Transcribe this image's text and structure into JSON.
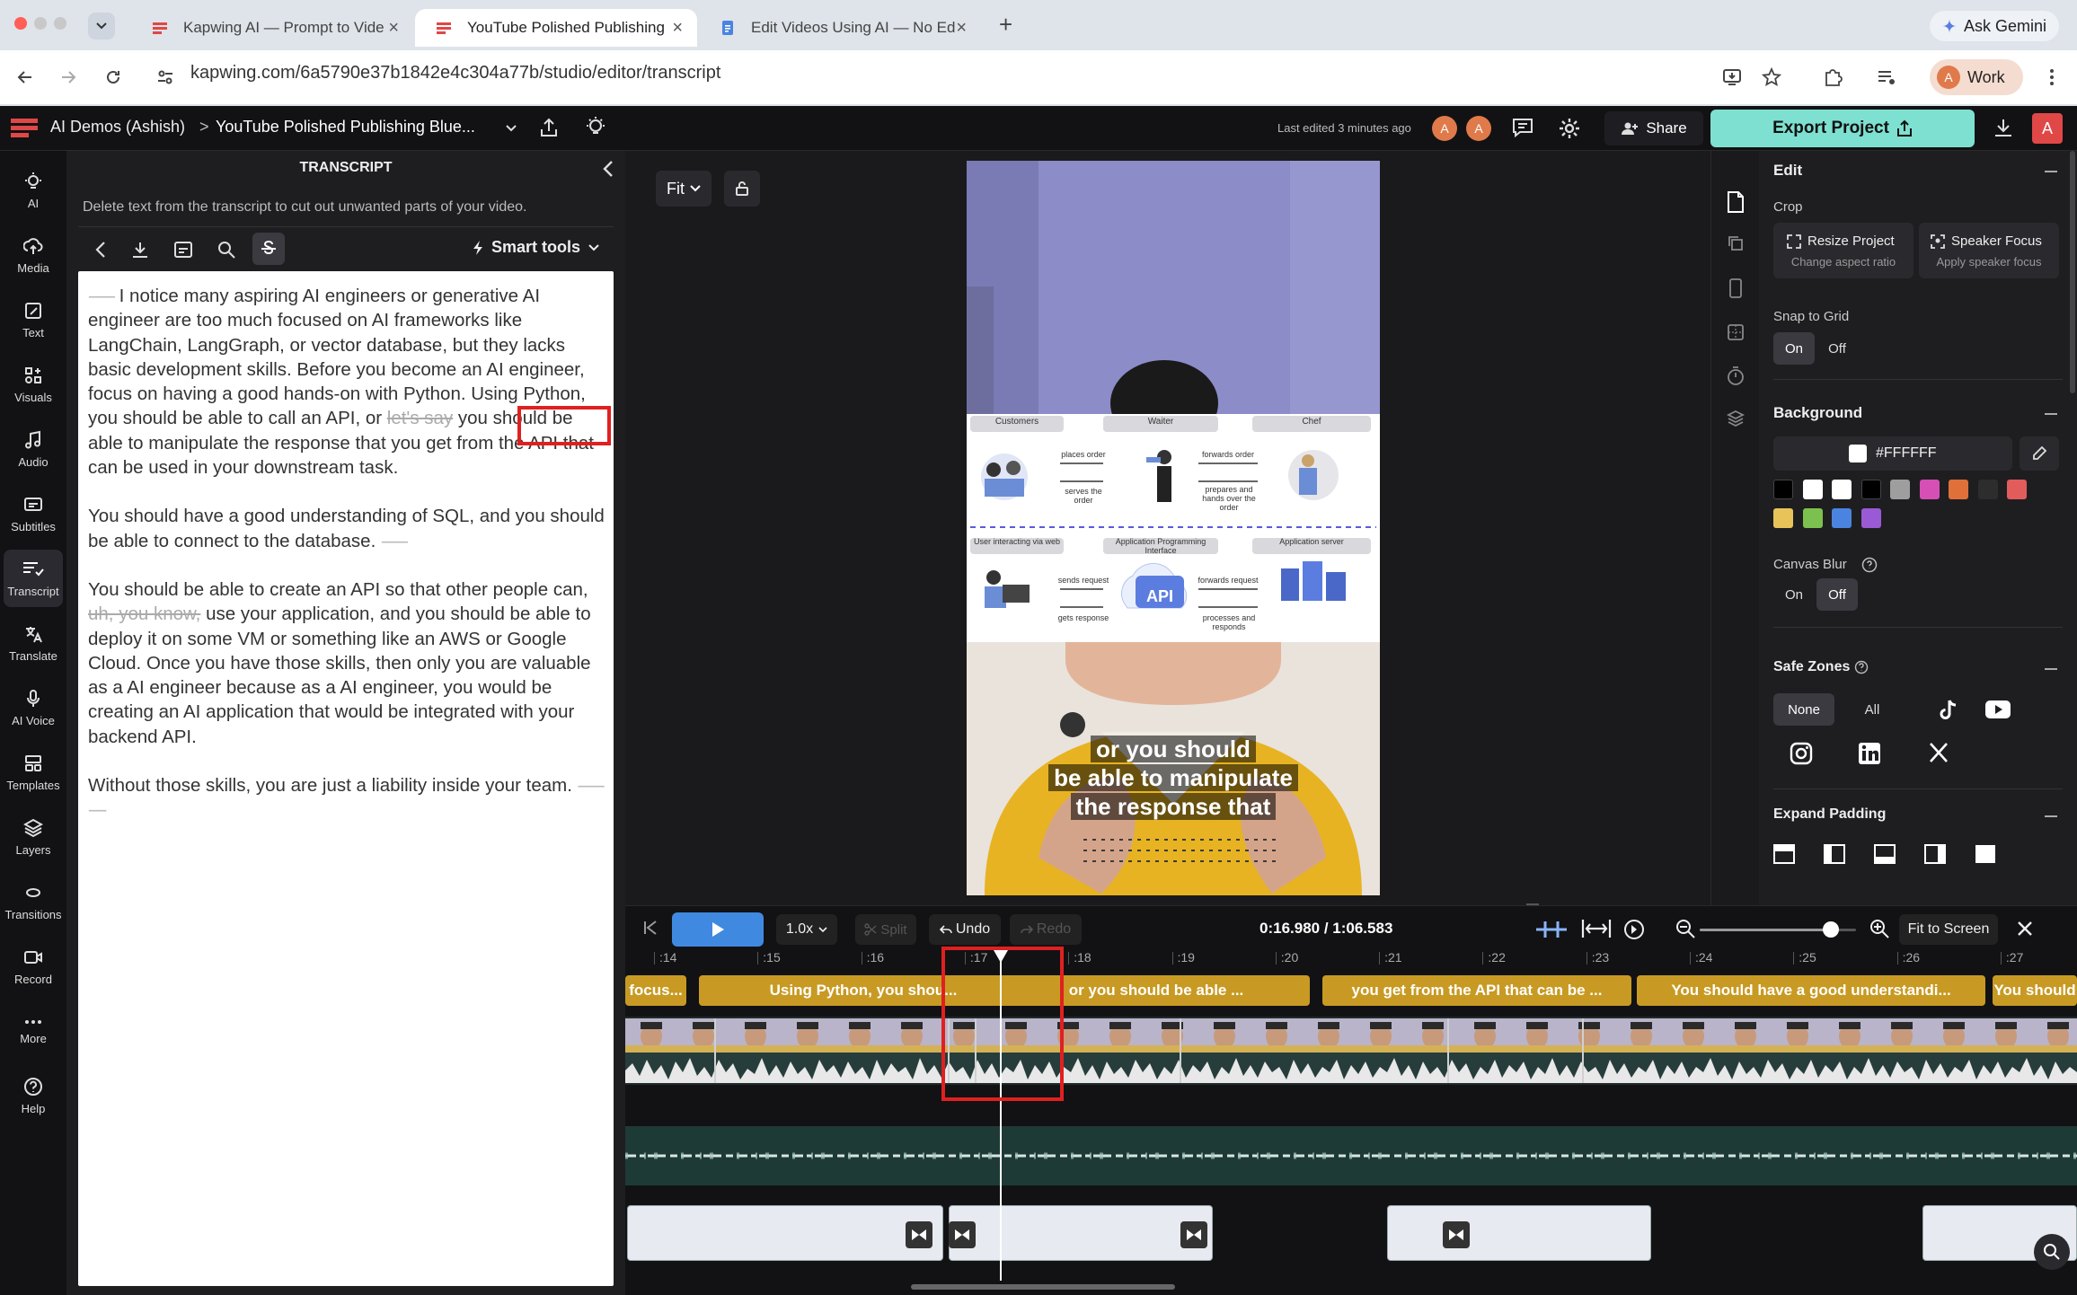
{
  "browser": {
    "tabs": [
      {
        "title": "Kapwing AI — Prompt to Vide",
        "active": false
      },
      {
        "title": "YouTube Polished Publishing",
        "active": true
      },
      {
        "title": "Edit Videos Using AI — No Ed",
        "active": false
      }
    ],
    "ask_gemini": "Ask Gemini",
    "url": "kapwing.com/6a5790e37b1842e4c304a77b/studio/editor/transcript",
    "profile": "Work",
    "profile_initial": "A"
  },
  "header": {
    "workspace": "AI Demos (Ashish)",
    "separator": ">",
    "project_title": "YouTube Polished Publishing Blue...",
    "last_edited": "Last edited 3 minutes ago",
    "avatar_initial": "A",
    "share_label": "Share",
    "export_label": "Export Project"
  },
  "left_nav": [
    {
      "label": "AI",
      "icon": "bulb-icon"
    },
    {
      "label": "Media",
      "icon": "upload-icon"
    },
    {
      "label": "Text",
      "icon": "text-edit-icon"
    },
    {
      "label": "Visuals",
      "icon": "visuals-icon"
    },
    {
      "label": "Audio",
      "icon": "music-icon"
    },
    {
      "label": "Subtitles",
      "icon": "subtitles-icon"
    },
    {
      "label": "Transcript",
      "icon": "transcript-icon"
    },
    {
      "label": "Translate",
      "icon": "translate-icon"
    },
    {
      "label": "AI Voice",
      "icon": "mic-icon"
    },
    {
      "label": "Templates",
      "icon": "templates-icon"
    },
    {
      "label": "Layers",
      "icon": "layers-icon"
    },
    {
      "label": "Transitions",
      "icon": "transitions-icon"
    },
    {
      "label": "Record",
      "icon": "record-icon"
    },
    {
      "label": "More",
      "icon": "more-icon"
    },
    {
      "label": "Help",
      "icon": "help-icon"
    }
  ],
  "transcript": {
    "title": "TRANSCRIPT",
    "hint": "Delete text from the transcript to cut out unwanted parts of your video.",
    "smart_tools": "Smart tools",
    "p1_dots": "------",
    "p1_a": " I notice many aspiring AI engineers or generative AI engineer are too much focused on AI frameworks like LangChain, LangGraph, or vector database, but they lacks basic development skills. Before you become an AI engineer, focus on having a good hands-on with Python. Using Python, you should be able to call an API, or ",
    "p1_strike": "let's say",
    "p1_b": " you should be able to manipulate the response that you get from the API that can be used in your downstream task.",
    "p2": "You should have a good understanding of SQL, and you should be able to connect to the database. ",
    "p2_dots": "------",
    "p3_a": "You should be able to create an API so that other people can, ",
    "p3_strike": "uh, you know,",
    "p3_b": " use your application, and you should be able to deploy it on some VM or something like an AWS or Google Cloud. Once you have those skills, then only you are valuable as a AI engineer because as a AI engineer, you would be creating an AI application that would be integrated with your backend API.",
    "p4": "Without those skills, you are just a liability inside your team. ",
    "p4_dots": "----------"
  },
  "canvas": {
    "fit_label": "Fit",
    "diagram": {
      "row1_labels": [
        "Customers",
        "Waiter",
        "Chef"
      ],
      "row1_arrows": [
        "places order",
        "serves the order",
        "forwards order",
        "prepares and hands over the order"
      ],
      "row2_labels": [
        "User interacting via web",
        "Application Programming Interface",
        "Application server"
      ],
      "row2_arrows": [
        "sends request",
        "gets response",
        "forwards request",
        "processes and responds"
      ],
      "api_badge": "API"
    },
    "caption_lines": [
      "or you should",
      "be able to manipulate",
      "the response that"
    ]
  },
  "right_panel": {
    "edit": "Edit",
    "crop": "Crop",
    "resize_title": "Resize Project",
    "resize_sub": "Change aspect ratio",
    "speaker_title": "Speaker Focus",
    "speaker_sub": "Apply speaker focus",
    "snap_to_grid": "Snap to Grid",
    "on": "On",
    "off": "Off",
    "background": "Background",
    "bg_hex": "#FFFFFF",
    "canvas_blur": "Canvas Blur",
    "safe_zones": "Safe Zones",
    "none": "None",
    "all": "All",
    "expand_padding": "Expand Padding",
    "swatches": [
      "#000000",
      "#ffffff",
      "#ffffff",
      "#000000",
      "#9e9e9e",
      "#d64fb5",
      "#e0703a",
      "#2d2d2d",
      "#e25c5c",
      "#e8c35a",
      "#7cc14f",
      "#4a84e0",
      "#9a5ad6"
    ]
  },
  "timeline": {
    "speed": "1.0x",
    "split": "Split",
    "undo": "Undo",
    "redo": "Redo",
    "time": "0:16.980 / 1:06.583",
    "fit_to_screen": "Fit to Screen",
    "zoom_level": 0.84,
    "ticks": [
      ":14",
      ":15",
      ":16",
      ":17",
      ":18",
      ":19",
      ":20",
      ":21",
      ":22",
      ":23",
      ":24",
      ":25",
      ":26",
      ":27"
    ],
    "captions": [
      "focus...",
      "Using Python, you shou...",
      "or you should be able ...",
      "you get from the API that can be ...",
      "You should have a good understandi...",
      "You should"
    ]
  }
}
